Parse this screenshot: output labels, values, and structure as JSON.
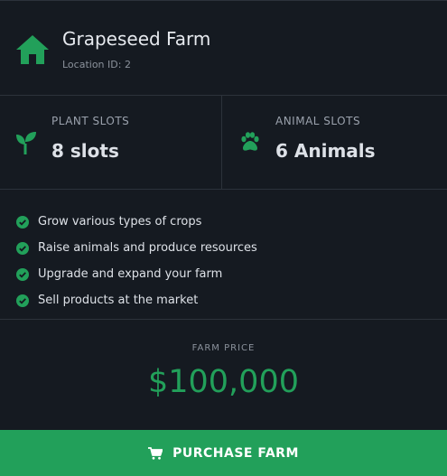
{
  "theme": {
    "accent": "#22a05a",
    "background": "#151a21",
    "divider": "#2c323b"
  },
  "header": {
    "icon": "home-icon",
    "title": "Grapeseed Farm",
    "location": "Location ID: 2"
  },
  "slots": {
    "plant": {
      "icon": "sprout-icon",
      "label": "PLANT SLOTS",
      "value": "8 slots"
    },
    "animal": {
      "icon": "paw-icon",
      "label": "ANIMAL SLOTS",
      "value": "6 Animals"
    }
  },
  "features": [
    {
      "icon": "check-circle-icon",
      "text": "Grow various types of crops"
    },
    {
      "icon": "check-circle-icon",
      "text": "Raise animals and produce resources"
    },
    {
      "icon": "check-circle-icon",
      "text": "Upgrade and expand your farm"
    },
    {
      "icon": "check-circle-icon",
      "text": "Sell products at the market"
    }
  ],
  "price": {
    "label": "FARM PRICE",
    "value": "$100,000"
  },
  "purchase": {
    "icon": "cart-icon",
    "label": "PURCHASE FARM"
  }
}
